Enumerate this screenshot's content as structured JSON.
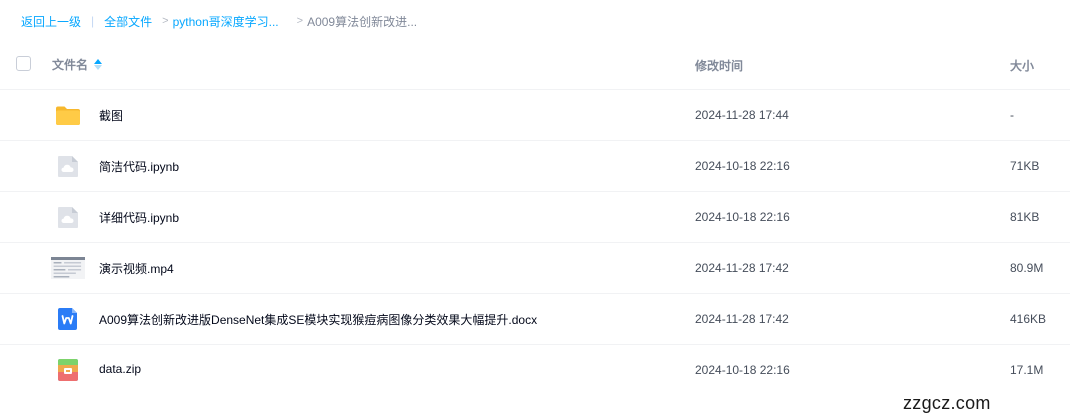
{
  "breadcrumb": {
    "back": "返回上一级",
    "separator": "|",
    "items": [
      "全部文件",
      "python哥深度学习...",
      "A009算法创新改进..."
    ]
  },
  "table": {
    "columns": {
      "name": "文件名",
      "modified": "修改时间",
      "size": "大小"
    },
    "rows": [
      {
        "name": "截图",
        "modified": "2024-11-28 17:44",
        "size": "-",
        "icon": "folder-icon"
      },
      {
        "name": "简洁代码.ipynb",
        "modified": "2024-10-18 22:16",
        "size": "71KB",
        "icon": "cloud-file-icon"
      },
      {
        "name": "详细代码.ipynb",
        "modified": "2024-10-18 22:16",
        "size": "81KB",
        "icon": "cloud-file-icon"
      },
      {
        "name": "演示视频.mp4",
        "modified": "2024-11-28 17:42",
        "size": "80.9M",
        "icon": "video-thumbnail-icon"
      },
      {
        "name": "A009算法创新改进版DenseNet集成SE模块实现猴痘病图像分类效果大幅提升.docx",
        "modified": "2024-11-28 17:42",
        "size": "416KB",
        "icon": "word-doc-icon"
      },
      {
        "name": "data.zip",
        "modified": "2024-10-18 22:16",
        "size": "17.1M",
        "icon": "zip-archive-icon"
      }
    ]
  },
  "watermark": "zzgcz.com",
  "colors": {
    "link": "#06a7ff",
    "text": "#03081a",
    "muted": "#818999",
    "folder": "#ffc53d",
    "word": "#2b7cf6"
  }
}
